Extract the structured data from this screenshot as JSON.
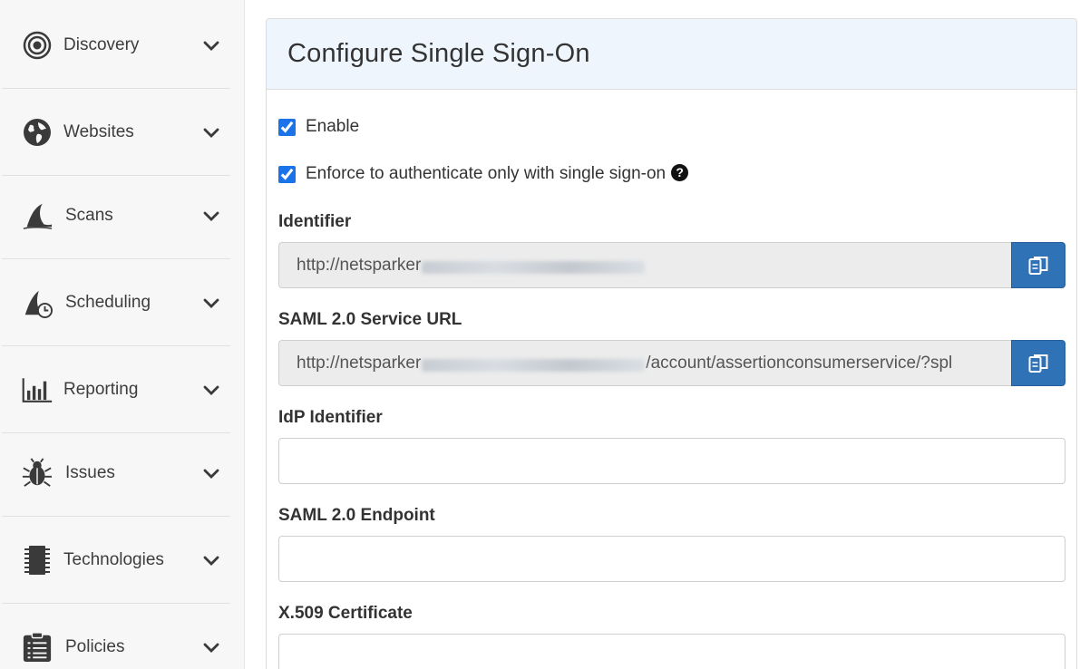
{
  "sidebar": {
    "items": [
      {
        "label": "Discovery",
        "icon": "target-icon"
      },
      {
        "label": "Websites",
        "icon": "globe-icon"
      },
      {
        "label": "Scans",
        "icon": "shark-fin-icon"
      },
      {
        "label": "Scheduling",
        "icon": "shark-fin-clock-icon"
      },
      {
        "label": "Reporting",
        "icon": "bar-chart-icon"
      },
      {
        "label": "Issues",
        "icon": "bug-icon"
      },
      {
        "label": "Technologies",
        "icon": "chip-icon"
      },
      {
        "label": "Policies",
        "icon": "clipboard-list-icon"
      }
    ]
  },
  "panel": {
    "title": "Configure Single Sign-On",
    "enable_label": "Enable",
    "enforce_label": "Enforce to authenticate only with single sign-on",
    "identifier": {
      "label": "Identifier",
      "value_prefix": "http://netsparker"
    },
    "saml_service_url": {
      "label": "SAML 2.0 Service URL",
      "value_prefix": "http://netsparker",
      "value_suffix": "/account/assertionconsumerservice/?spl"
    },
    "idp_identifier": {
      "label": "IdP Identifier",
      "value": ""
    },
    "saml_endpoint": {
      "label": "SAML 2.0 Endpoint",
      "value": ""
    },
    "x509": {
      "label": "X.509 Certificate",
      "value": ""
    }
  },
  "colors": {
    "accent": "#2f72b6",
    "header_bg": "#eef5fc",
    "checkbox": "#1a73e8"
  }
}
